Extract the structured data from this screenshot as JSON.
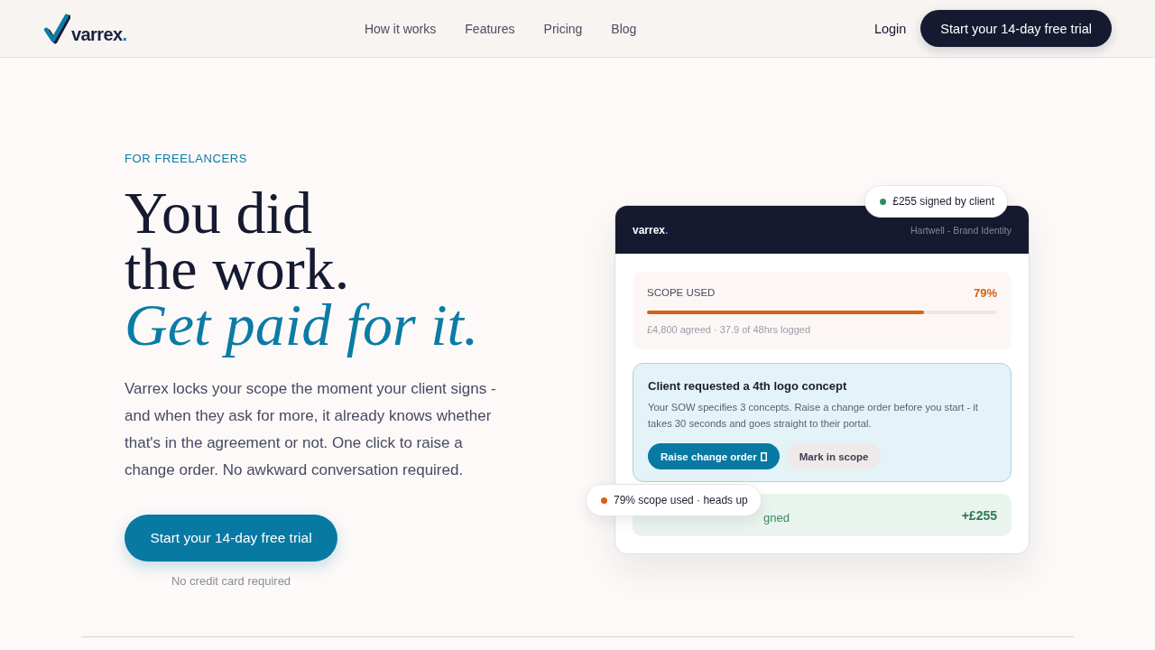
{
  "nav": {
    "logo": {
      "name": "varrex",
      "dot": "."
    },
    "links": [
      {
        "label": "How it works"
      },
      {
        "label": "Features"
      },
      {
        "label": "Pricing"
      },
      {
        "label": "Blog"
      }
    ],
    "login": "Login",
    "cta": "Start your 14-day free trial"
  },
  "hero": {
    "eyebrow": "FOR FREELANCERS",
    "headline": [
      "You did",
      "the work."
    ],
    "accent": "Get paid for it.",
    "description": "Varrex locks your scope the moment your client signs - and when they ask for more, it already knows whether that's in the agreement or not. One click to raise a change order. No awkward conversation required.",
    "cta": "Start your 14-day free trial",
    "note": "No credit card required"
  },
  "preview": {
    "brand": {
      "name": "varrex",
      "dot": "."
    },
    "project": "Hartwell - Brand Identity",
    "scope": {
      "label": "SCOPE USED",
      "percent": "79%",
      "level": 0.79,
      "detail": "£4,800 agreed · 37.9 of 48hrs logged"
    },
    "request": {
      "title": "Client requested a 4th logo concept",
      "body": "Your SOW specifies 3 concepts. Raise a change order before you start - it takes 30 seconds and goes straight to their portal.",
      "actions": [
        {
          "label": "Raise change order",
          "kind": "primary"
        },
        {
          "label": "Mark in scope",
          "kind": "secondary"
        }
      ]
    },
    "signed": {
      "label": "gned",
      "amount": "+£255"
    },
    "toasts": [
      {
        "text": "£255 signed by client",
        "color": "#2e8b65"
      },
      {
        "text": "79% scope used · heads up",
        "color": "#d9600e"
      }
    ]
  }
}
